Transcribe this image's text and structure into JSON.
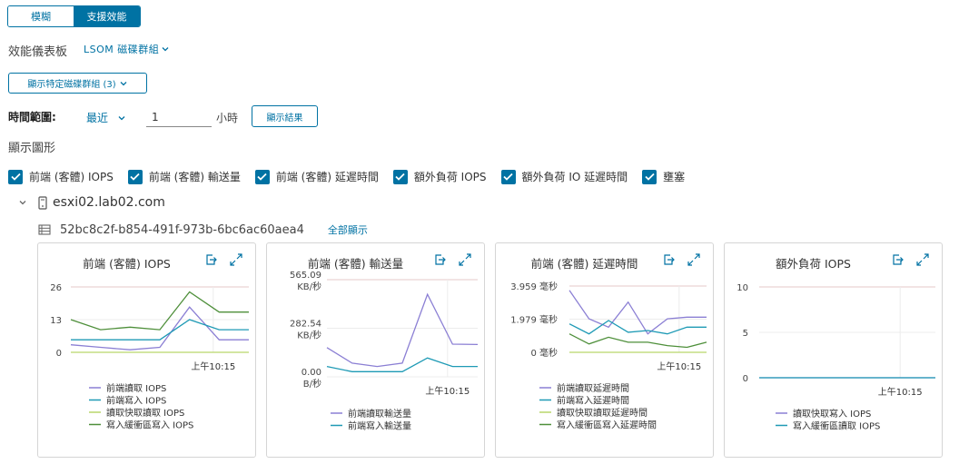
{
  "tabs": {
    "left": "模糊",
    "right": "支援效能"
  },
  "dashboard": {
    "label": "效能儀表板",
    "selected": "LSOM 磁碟群組"
  },
  "group_button": "顯示特定磁碟群組 (3)",
  "time_range": {
    "label": "時間範圍:",
    "mode": "最近",
    "value": "1",
    "unit": "小時",
    "show_button": "顯示結果"
  },
  "graphs_label": "顯示圖形",
  "checkboxes": [
    "前端 (客體) IOPS",
    "前端 (客體) 輸送量",
    "前端 (客體) 延遲時間",
    "額外負荷 IOPS",
    "額外負荷 IO 延遲時間",
    "壅塞"
  ],
  "host": "esxi02.lab02.com",
  "disk_group": {
    "id": "52bc8c2f-b854-491f-973b-6bc6ac60aea4",
    "show_all": "全部顯示"
  },
  "colors": {
    "purple": "#8b7fd4",
    "teal": "#1e9ab5",
    "lime": "#b9d66a",
    "green": "#4e8f3a",
    "accent": "#0072a3"
  },
  "chart_data": [
    {
      "type": "line",
      "title": "前端 (客體) IOPS",
      "ylim": [
        0,
        26
      ],
      "yticks": [
        "26",
        "13",
        "0"
      ],
      "xtick": "上午10:15",
      "x": [
        0,
        1,
        2,
        3,
        4,
        5,
        6
      ],
      "series": [
        {
          "name": "前端讀取 IOPS",
          "color": "#8b7fd4",
          "values": [
            3,
            2,
            1,
            2,
            18,
            5,
            5
          ]
        },
        {
          "name": "前端寫入 IOPS",
          "color": "#1e9ab5",
          "values": [
            5,
            5,
            5,
            5,
            13,
            9,
            9
          ]
        },
        {
          "name": "讀取快取讀取 IOPS",
          "color": "#b9d66a",
          "values": [
            0,
            0,
            0,
            0,
            0,
            0,
            0
          ]
        },
        {
          "name": "寫入緩衝區寫入 IOPS",
          "color": "#4e8f3a",
          "values": [
            13,
            9,
            10,
            9,
            24,
            16,
            16
          ]
        }
      ]
    },
    {
      "type": "line",
      "title": "前端 (客體) 輸送量",
      "ylim": [
        0,
        565.09
      ],
      "yticks": [
        "565.09 KB/秒",
        "282.54 KB/秒",
        "0.00 B/秒"
      ],
      "xtick": "上午10:15",
      "x": [
        0,
        1,
        2,
        3,
        4,
        5,
        6
      ],
      "series": [
        {
          "name": "前端讀取輸送量",
          "color": "#8b7fd4",
          "values": [
            170,
            80,
            60,
            80,
            480,
            190,
            188
          ]
        },
        {
          "name": "前端寫入輸送量",
          "color": "#1e9ab5",
          "values": [
            60,
            30,
            30,
            30,
            110,
            60,
            60
          ]
        }
      ]
    },
    {
      "type": "line",
      "title": "前端 (客體) 延遲時間",
      "ylim": [
        0,
        3.959
      ],
      "yticks": [
        "3.959 毫秒",
        "1.979 毫秒",
        "0 毫秒"
      ],
      "xtick": "上午10:15",
      "x": [
        0,
        1,
        2,
        3,
        4,
        5,
        6,
        7
      ],
      "series": [
        {
          "name": "前端讀取延遲時間",
          "color": "#8b7fd4",
          "values": [
            3.7,
            2.0,
            1.5,
            3.0,
            1.1,
            2.0,
            2.1,
            2.1
          ]
        },
        {
          "name": "前端寫入延遲時間",
          "color": "#1e9ab5",
          "values": [
            1.7,
            1.1,
            1.9,
            1.2,
            1.3,
            1.1,
            1.5,
            1.5
          ]
        },
        {
          "name": "讀取快取讀取延遲時間",
          "color": "#b9d66a",
          "values": [
            0,
            0,
            0,
            0,
            0,
            0,
            0,
            0
          ]
        },
        {
          "name": "寫入緩衝區寫入延遲時間",
          "color": "#4e8f3a",
          "values": [
            1.1,
            0.5,
            0.9,
            0.6,
            0.6,
            0.4,
            0.3,
            0.6
          ]
        }
      ]
    },
    {
      "type": "line",
      "title": "額外負荷 IOPS",
      "ylim": [
        0,
        10
      ],
      "yticks": [
        "10",
        "5",
        "0"
      ],
      "xtick": "上午10:15",
      "x": [
        0,
        1,
        2,
        3,
        4,
        5,
        6
      ],
      "series": [
        {
          "name": "讀取快取寫入 IOPS",
          "color": "#8b7fd4",
          "values": [
            0,
            0,
            0,
            0,
            0,
            0,
            0
          ]
        },
        {
          "name": "寫入緩衝區讀取 IOPS",
          "color": "#1e9ab5",
          "values": [
            0,
            0,
            0,
            0,
            0,
            0,
            0
          ]
        }
      ]
    }
  ]
}
